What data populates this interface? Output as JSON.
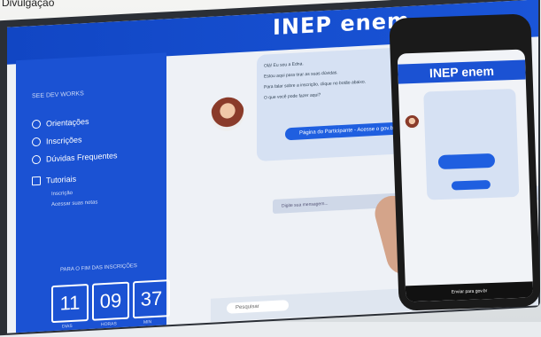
{
  "caption": "Divulgação",
  "monitor": {
    "logo": "INEP enem",
    "sidebar": {
      "title": "SEE DEV WORKS",
      "items": [
        {
          "label": "Orientações",
          "icon": "clipboard-icon"
        },
        {
          "label": "Inscrições",
          "icon": "user-icon"
        },
        {
          "label": "Dúvidas Frequentes",
          "icon": "question-icon"
        },
        {
          "label": "Tutoriais",
          "icon": "video-icon"
        }
      ],
      "sub_items": [
        "Inscrição",
        "Acessar suas notas"
      ],
      "countdown_label": "PARA O FIM DAS INSCRIÇÕES",
      "countdown": {
        "days": "11",
        "hours": "09",
        "minutes": "37",
        "units": [
          "DIAS",
          "HORAS",
          "MIN"
        ]
      }
    },
    "chat": {
      "lines": [
        "Olá! Eu sou a Edna.",
        "Estou aqui para tirar as suas dúvidas.",
        "Para falar sobre a inscrição, clique no botão abaixo.",
        "O que você pode fazer aqui?"
      ],
      "button": "Página do Participante - Acesse o gov.br",
      "input_placeholder": "Digite sua mensagem..."
    },
    "taskbar": {
      "search": "Pesquisar"
    }
  },
  "phone": {
    "logo": "INEP enem",
    "footer": "Enviar para gov.br"
  }
}
